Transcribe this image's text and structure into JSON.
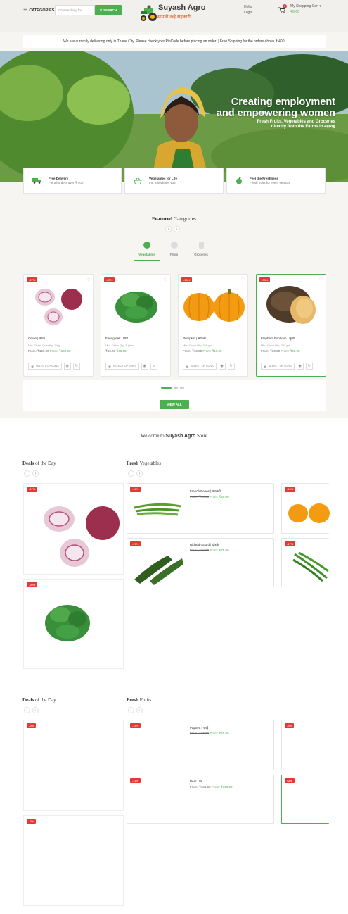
{
  "header": {
    "categories_label": "CATEGORIES",
    "search_placeholder": "I'm searching for...",
    "search_button": "SEARCH",
    "logo_title": "Suyash Agro",
    "logo_tagline": "व्यापारी नव्हे सहकारी",
    "hello": "Hello",
    "login": "Login",
    "cart_label": "My Shopping Cart",
    "cart_count": "0",
    "cart_total": "₹0.00",
    "brand_color": "#4caf50"
  },
  "notice": "We are currently delivering only in Thane City. Please check your PinCode before placing an order! | Free Shipping for the orders above ₹ 400.",
  "hero": {
    "line1": "Creating employment",
    "line2": "and empowering women",
    "sub1": "Fresh Fruits, Vegetables and Groceries",
    "sub2": "directly from the Farms in महाराष्ट्र"
  },
  "features": [
    {
      "title": "Free Delivery",
      "text": "For all orders over ₹ 400",
      "icon": "truck-icon"
    },
    {
      "title": "Vegetables for Life",
      "text": "For a healthier you",
      "icon": "basket-icon"
    },
    {
      "title": "Feel the Freshness",
      "text": "Fresh fruits for every season",
      "icon": "apple-icon"
    }
  ],
  "featured": {
    "title_bold": "Featured",
    "title_rest": " Categories",
    "tabs": [
      {
        "label": "Vegetables"
      },
      {
        "label": "Fruits"
      },
      {
        "label": "Groceries"
      }
    ],
    "products": [
      {
        "badge": "-17%",
        "name": "Onion | कांदा",
        "min": "Min. Order Quantity: 1 Kg",
        "old": "From: ₹120.00",
        "new": "From: ₹100.00"
      },
      {
        "badge": "-20%",
        "name": "Fenugreek | मेथी",
        "min": "Min. Order Qty: 1 piece",
        "old": "₹50.00",
        "new": "₹40.00"
      },
      {
        "badge": "-16%",
        "name": "Pumpkin | भोपळा",
        "min": "Min. Order Qty: 250 gm",
        "old": "From: ₹19.00",
        "new": "From: ₹16.00"
      },
      {
        "badge": "-33%",
        "name": "Elephant Footyam | सुरण",
        "min": "Min. Order Qty: 250 gm",
        "old": "From: ₹30.00",
        "new": "From: ₹20.00"
      }
    ],
    "select_options": "SELECT OPTIONS",
    "view_all": "VIEW ALL"
  },
  "welcome": {
    "pre": "Welcome to ",
    "bold": "Suyash Agro",
    "post": " Store"
  },
  "block1": {
    "left_bold": "Deals",
    "left_rest": " of the Day",
    "right_bold": "Fresh",
    "right_rest": " Vegetables",
    "deals": [
      {
        "badge": "-17%"
      },
      {
        "badge": "-20%"
      }
    ],
    "items": [
      {
        "badge": "-17%",
        "name": "French Beans | फरसबी",
        "old": "From: ₹60.00",
        "new": "From: ₹50.00"
      },
      {
        "badge": "-17%",
        "name": "Ridged Gourd | दोडके",
        "old": "From: ₹30.00",
        "new": "From: ₹25.00"
      }
    ],
    "side_badges": [
      "-16%",
      "-17%"
    ]
  },
  "block2": {
    "left_bold": "Deals",
    "left_rest": " of the Day",
    "right_bold": "Fresh",
    "right_rest": " Fruits",
    "deals": [
      {
        "badge": "-9%"
      },
      {
        "badge": "-6%"
      }
    ],
    "items": [
      {
        "badge": "-14%",
        "name": "Papaya | पपई",
        "old": "From: ₹70.00",
        "new": "From: ₹60.00"
      },
      {
        "badge": "-11%",
        "name": "Pear | पेर",
        "old": "From: ₹180.00",
        "new": "From: ₹160.00"
      }
    ],
    "side_badges": [
      "-8%",
      "Sale"
    ]
  }
}
